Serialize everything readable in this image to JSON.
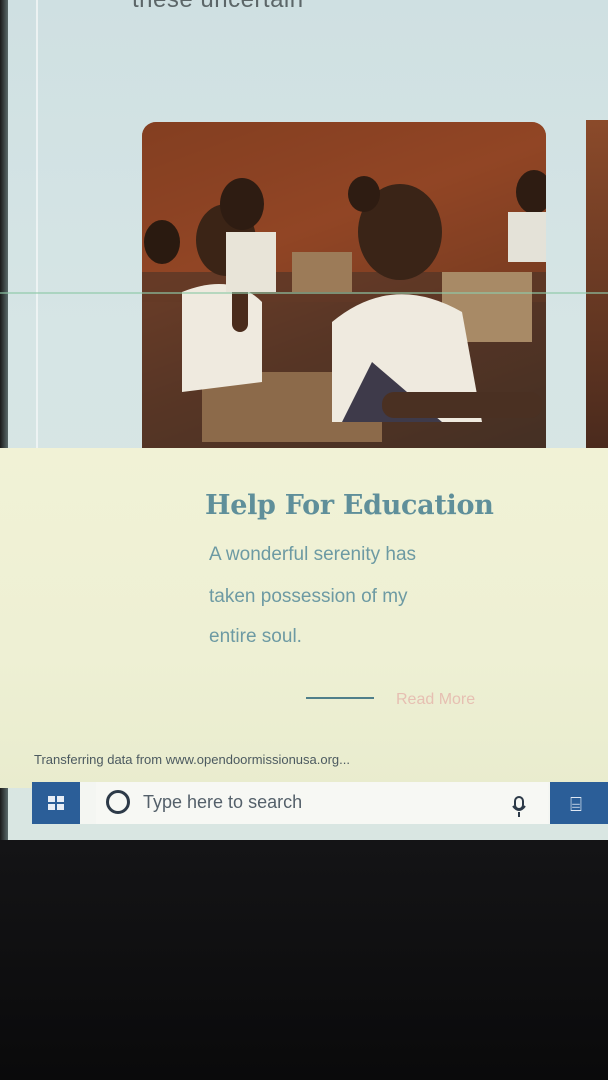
{
  "page": {
    "top_partial_text": "these uncertain",
    "card": {
      "title": "Help For Education",
      "text_lines": [
        "A wonderful serenity has",
        "taken possession of my",
        "entire soul."
      ],
      "read_more_label": "Read More"
    },
    "status_bar_text": "Transferring data from www.opendoormissionusa.org..."
  },
  "taskbar": {
    "search_placeholder": "Type here to search",
    "start_icon": "windows-logo-icon",
    "search_icon": "cortana-ring-icon",
    "mic_icon": "microphone-icon",
    "task_view_icon": "task-view-icon"
  },
  "colors": {
    "title": "#5f8f9a",
    "body_text": "#6d9aa3",
    "read_more": "#e6bfb2",
    "taskbar_accent": "#2b5e98",
    "card_bg": "#f1f2d6",
    "page_bg": "#d6e5e5"
  }
}
